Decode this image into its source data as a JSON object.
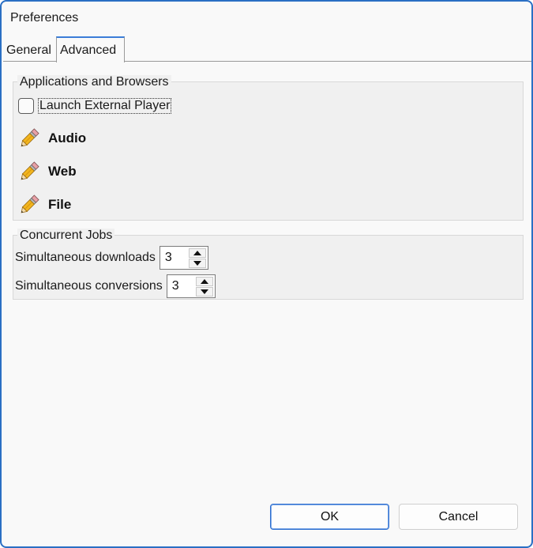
{
  "window": {
    "title": "Preferences",
    "accent_color": "#2a6fc4"
  },
  "tabs": [
    {
      "label": "General",
      "selected": false
    },
    {
      "label": "Advanced",
      "selected": true
    }
  ],
  "applications_group": {
    "title": "Applications and Browsers",
    "launch_external_player": {
      "label": "Launch External Player",
      "checked": false
    },
    "items": [
      {
        "label": "Audio",
        "icon": "pencil-icon"
      },
      {
        "label": "Web",
        "icon": "pencil-icon"
      },
      {
        "label": "File",
        "icon": "pencil-icon"
      }
    ]
  },
  "jobs_group": {
    "title": "Concurrent Jobs",
    "simultaneous_downloads": {
      "label": "Simultaneous downloads",
      "value": "3"
    },
    "simultaneous_conversions": {
      "label": "Simultaneous conversions",
      "value": "3"
    }
  },
  "buttons": {
    "ok": "OK",
    "cancel": "Cancel"
  }
}
